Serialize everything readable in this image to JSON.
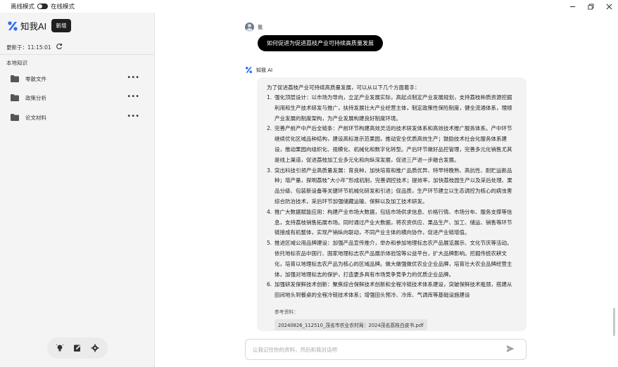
{
  "topbar": {
    "offline_label": "离线模式",
    "online_label": "在线模式",
    "controls": [
      "minimize-icon",
      "restore-icon",
      "close-icon"
    ]
  },
  "sidebar": {
    "brand_name": "知我AI",
    "new_button": "新增",
    "updated_label": "更新于：",
    "updated_time": "11:15:01",
    "kb_title": "本地知识",
    "folders": [
      {
        "label": "零散文件",
        "icon": "folder-icon",
        "more": "•••"
      },
      {
        "label": "政策分析",
        "icon": "folder-icon",
        "more": "•••"
      },
      {
        "label": "论文材料",
        "icon": "folder-icon",
        "more": "•••"
      }
    ],
    "tools": [
      "bulb-icon",
      "edit-icon",
      "gear-icon"
    ]
  },
  "chat": {
    "user_name": "我",
    "user_message": "如何促进为促进荔枝产业可持续高质量发展",
    "ai_name": "知我 AI",
    "answer_intro": "为了促进荔枝产业可持续高质量发展，可以从以下几个方面着手：",
    "points": [
      {
        "num": "1.",
        "text": "强化顶层设计：以市场为导向，立足产业发展实际，高起点制定产业发展规划，支持荔枝种质资源挖掘利用和生产技术研发与推广，扶持发展壮大产业经营主体，制定政策性保险制度，健全流通体系，理顺产业发展的制度架构，为产业发展构建良好制度环境。"
      },
      {
        "num": "2.",
        "text": "完善产前产中产后全链条：产前环节构建高效灵活的技术研发体系和高效技术推广服务体系。产中环节继续优化区域品种结构，建设高标准示范果园，推动安全优质高效生产；鼓励技术社会化服务体系建设，推动果园向组织化、规模化、机械化和数字化转型。产后环节做好品控管理，完善多元化销售尤其是线上渠道，促进荔枝加工业多元化和向纵深发展，促进三产进一步融合发展。"
      },
      {
        "num": "3.",
        "text": "突出科技引领产业高质量发展：育良种，加快培育和推广品质优异、特早特晚熟、高抗性、耐贮运新品种；增产量，探明荔枝“大小年”形成机制，完善调控技术；提效率，加快荔枝园生产以及采后处理、果品分级、包装新设备等关键环节机械化研发和引进；促品质，生产环节建立以生态调控为核心的病虫害综合防治技术，采后环节加强储藏运输、保鲜以及加工技术研发。"
      },
      {
        "num": "4.",
        "text": "推广大数据赋能应用：构建产业市场大数据，包括市场供求信息、价格行情、市场分布、服务支撑等信息，支持荔枝销售拓展市场。同时通过产业大数据，将农资供应、果品生产、加工、储运、销售等环节链接成有机整体，实现产销纵向联动，不同产业主体的横向协作，促进产业链增值。"
      },
      {
        "num": "5.",
        "text": "推进区域公用品牌建设：加强产品宣传推介，举办和参加地理标志农产品展览展示、文化节庆等活动。依托地标农品中国行、国家地理标志农产品展示体验馆等公益平台，扩大品牌影响。挖掘传统农耕文化，培育以地理标志农产品为核心的区域品牌。做大做强做优农业企业品牌，培育壮大农业品牌经营主体，加强对地理标志的保护，打造更多具有市场竞争竞争力的优质企业品牌。"
      },
      {
        "num": "6.",
        "text": "加强研发保鲜技术创新：聚焦综合保鲜技术创新和全程冷链技术体系建设，突破保鲜技术瓶颈，搭建从田间地头到餐桌的全程冷链技术体系；增强田头预冷、冷库、气调库等基础设施建设"
      }
    ],
    "reference_label": "参考资料：",
    "reference_file": "20240826_112510_茂名市农业农村局：2024茂名荔枝白皮书.pdf",
    "input_placeholder": "让我记住你的资料，然后和我对话吧"
  },
  "colors": {
    "sidebar_bg": "#f4f4f4",
    "user_bubble": "#000000",
    "answer_bg": "#f3f3f3",
    "logo_blue": "#2d6cf0"
  }
}
